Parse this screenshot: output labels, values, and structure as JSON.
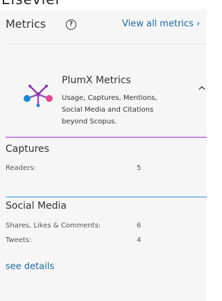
{
  "top_clipped_text": "Elsevier",
  "metrics_panel": {
    "title": "Metrics",
    "help_icon_glyph": "?",
    "view_all_label": "View all metrics ›"
  },
  "plumx": {
    "title": "PlumX Metrics",
    "description_lines": [
      "Usage, Captures, Mentions,",
      "Social Media and Citations",
      "beyond Scopus."
    ],
    "accent_color": "#c98ad6",
    "logo_colors": [
      "#8b3aa8",
      "#1e88c7",
      "#e14c8f",
      "#2e7fb8",
      "#9d4fbd"
    ]
  },
  "captures": {
    "title": "Captures",
    "rows": [
      {
        "label": "Readers:",
        "value": "5"
      }
    ]
  },
  "social_media": {
    "title": "Social Media",
    "accent_color": "#87c3eb",
    "rows": [
      {
        "label": "Shares, Likes & Comments:",
        "value": "6"
      },
      {
        "label": "Tweets:",
        "value": "4"
      }
    ]
  },
  "see_details_label": "see details"
}
